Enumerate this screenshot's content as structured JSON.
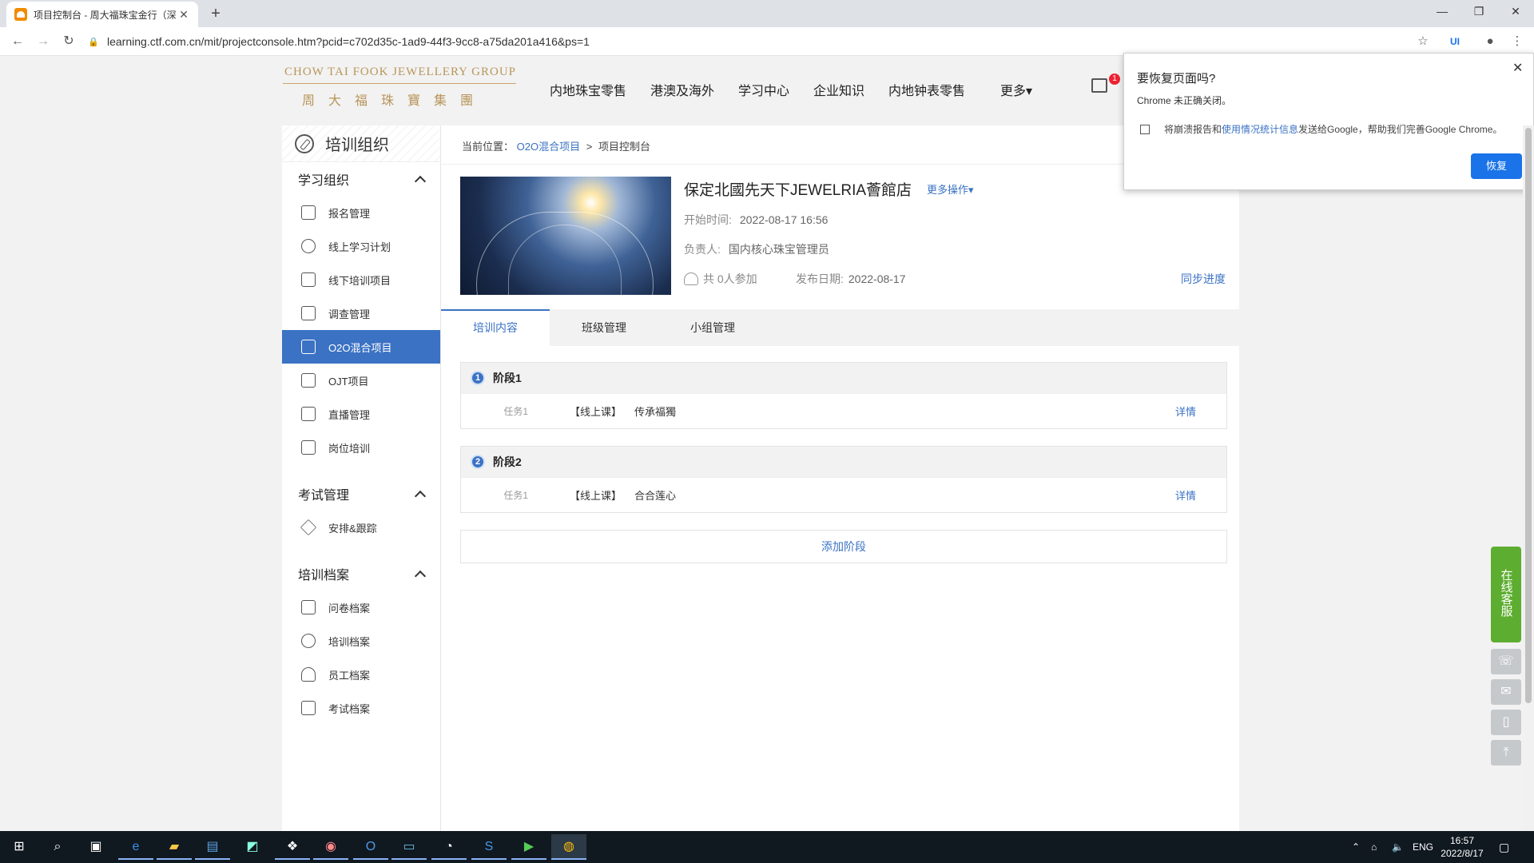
{
  "browser": {
    "tab_title": "项目控制台 - 周大福珠宝金行（深",
    "url": "learning.ctf.com.cn/mit/projectconsole.htm?pcid=c702d35c-1ad9-44f3-9cc8-a75da201a416&ps=1"
  },
  "header": {
    "logo_en": "CHOW TAI FOOK JEWELLERY GROUP",
    "logo_cn": "周大福珠寶集團",
    "nav": [
      "内地珠宝零售",
      "港澳及海外",
      "学习中心",
      "企业知识",
      "内地钟表零售",
      "更多▾"
    ],
    "badge": "1"
  },
  "sidebar": {
    "title": "培训组织",
    "sections": [
      {
        "label": "学习组织",
        "items": [
          "报名管理",
          "线上学习计划",
          "线下培训项目",
          "调查管理",
          "O2O混合项目",
          "OJT项目",
          "直播管理",
          "岗位培训"
        ]
      },
      {
        "label": "考试管理",
        "items": [
          "安排&跟踪"
        ]
      },
      {
        "label": "培训档案",
        "items": [
          "问卷档案",
          "培训档案",
          "员工档案",
          "考试档案"
        ]
      }
    ],
    "active_item": "O2O混合项目"
  },
  "breadcrumb": {
    "prefix": "当前位置：",
    "link": "O2O混合项目",
    "sep": ">",
    "current": "项目控制台"
  },
  "project": {
    "title": "保定北國先天下JEWELRIA薈館店",
    "more_ops": "更多操作▾",
    "start_label": "开始时间:",
    "start_value": "2022-08-17 16:56",
    "owner_label": "负责人:",
    "owner_value": "国内核心珠宝管理员",
    "participants": "共 0人参加",
    "publish_label": "发布日期:",
    "publish_value": "2022-08-17",
    "sync": "同步进度"
  },
  "tabs": [
    "培训内容",
    "班级管理",
    "小组管理"
  ],
  "stages": [
    {
      "num": "1",
      "title": "阶段1",
      "task": "任务1",
      "kind": "【线上课】",
      "name": "传承福獨",
      "detail": "详情"
    },
    {
      "num": "2",
      "title": "阶段2",
      "task": "任务1",
      "kind": "【线上课】",
      "name": "合合莲心",
      "detail": "详情"
    }
  ],
  "add_stage": "添加阶段",
  "restore": {
    "title": "要恢复页面吗?",
    "subtitle": "Chrome 未正确关闭。",
    "msg_a": "将崩溃报告和",
    "msg_link": "使用情况统计信息",
    "msg_b": "发送给Google，帮助我们完善Google Chrome。",
    "button": "恢复"
  },
  "service": {
    "label": "在线客服"
  },
  "taskbar": {
    "lang": "ENG",
    "time": "16:57",
    "date": "2022/8/17"
  }
}
